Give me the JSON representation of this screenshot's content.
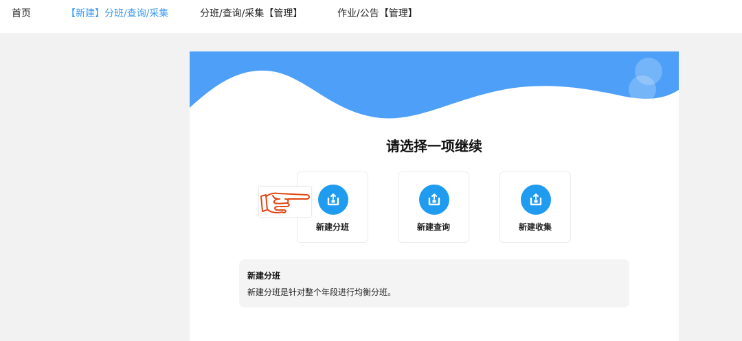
{
  "nav": {
    "items": [
      {
        "label": "首页",
        "active": false
      },
      {
        "label": "【新建】分班/查询/采集",
        "active": true
      },
      {
        "label": "分班/查询/采集【管理】",
        "active": false
      },
      {
        "label": "作业/公告【管理】",
        "active": false
      }
    ]
  },
  "main": {
    "heading": "请选择一项继续",
    "options": [
      {
        "label": "新建分班",
        "icon": "upload-box-icon"
      },
      {
        "label": "新建查询",
        "icon": "upload-box-icon"
      },
      {
        "label": "新建收集",
        "icon": "upload-box-icon"
      }
    ],
    "description": {
      "title": "新建分班",
      "body": "新建分班是针对整个年段进行均衡分班。"
    }
  },
  "overlay": {
    "icon": "pointing-hand-icon"
  },
  "colors": {
    "accent": "#3d9bf0",
    "wave": "#4d9ff8",
    "icon_circle": "#1f9bf0",
    "hand_stroke": "#e0450f"
  }
}
